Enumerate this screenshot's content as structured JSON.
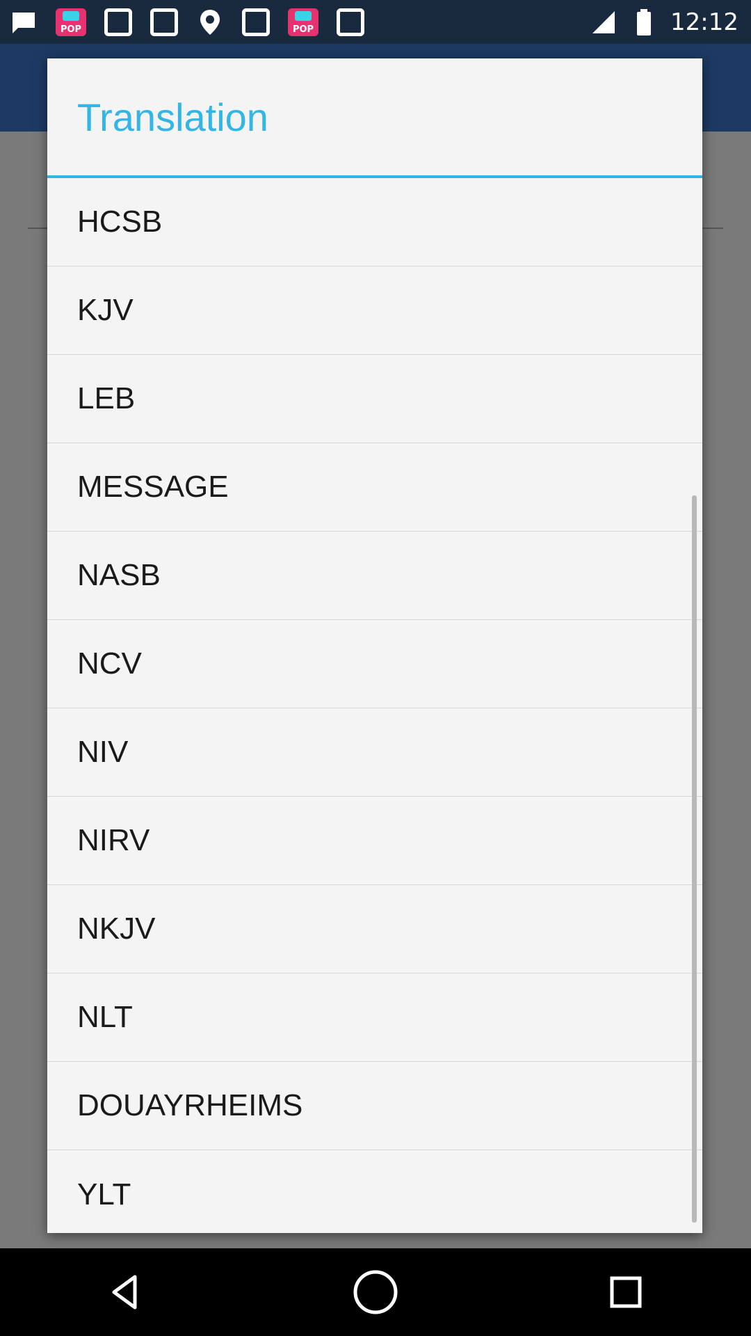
{
  "status_bar": {
    "time": "12:12",
    "left_icons": [
      "message-icon",
      "pop-app-icon",
      "square-icon",
      "square-icon",
      "location-icon",
      "square-icon",
      "pop-app-icon",
      "square-icon"
    ],
    "right_icons": [
      "signal-icon",
      "battery-icon"
    ]
  },
  "dialog": {
    "title": "Translation",
    "accent_color": "#33b5e5",
    "items": [
      {
        "label": "HCSB"
      },
      {
        "label": "KJV"
      },
      {
        "label": "LEB"
      },
      {
        "label": "MESSAGE"
      },
      {
        "label": "NASB"
      },
      {
        "label": "NCV"
      },
      {
        "label": "NIV"
      },
      {
        "label": "NIRV"
      },
      {
        "label": "NKJV"
      },
      {
        "label": "NLT"
      },
      {
        "label": "DOUAYRHEIMS"
      },
      {
        "label": "YLT"
      }
    ]
  },
  "nav_bar": {
    "buttons": [
      "back-icon",
      "home-icon",
      "recents-icon"
    ]
  }
}
